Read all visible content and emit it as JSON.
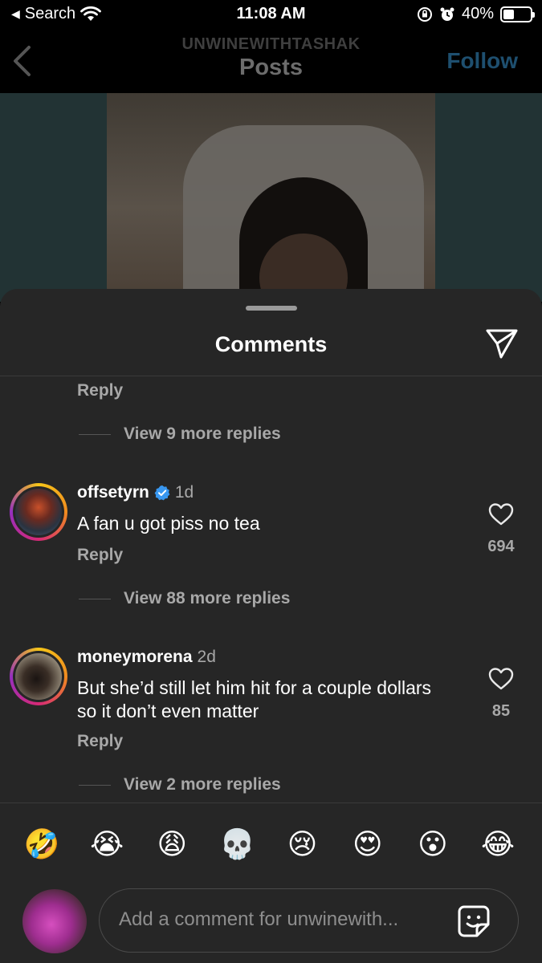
{
  "status_bar": {
    "back_label": "Search",
    "time": "11:08 AM",
    "battery": "40%",
    "battery_level": 0.4
  },
  "header": {
    "subtitle": "UNWINEWITHTASHAK",
    "title": "Posts",
    "follow_label": "Follow"
  },
  "sheet": {
    "title": "Comments",
    "top_reply": "Reply",
    "top_view_more": "View 9 more replies"
  },
  "comments": [
    {
      "username": "offsetyrn",
      "verified": true,
      "time": "1d",
      "text": "A fan u got piss no tea",
      "likes": "694",
      "reply": "Reply",
      "view_more": "View 88 more replies"
    },
    {
      "username": "moneymorena",
      "verified": false,
      "time": "2d",
      "text": "But she’d still let him hit for a couple dollars so it don’t even matter",
      "likes": "85",
      "reply": "Reply",
      "view_more": "View 2 more replies"
    }
  ],
  "emoji_bar": [
    "🤣",
    "😭",
    "😩",
    "💀",
    "😢",
    "😍",
    "😮",
    "😂"
  ],
  "composer": {
    "placeholder": "Add a comment for unwinewith..."
  },
  "colors": {
    "sheet_bg": "#262626",
    "secondary_text": "#a8a8a8",
    "verified_blue": "#3897f0"
  }
}
